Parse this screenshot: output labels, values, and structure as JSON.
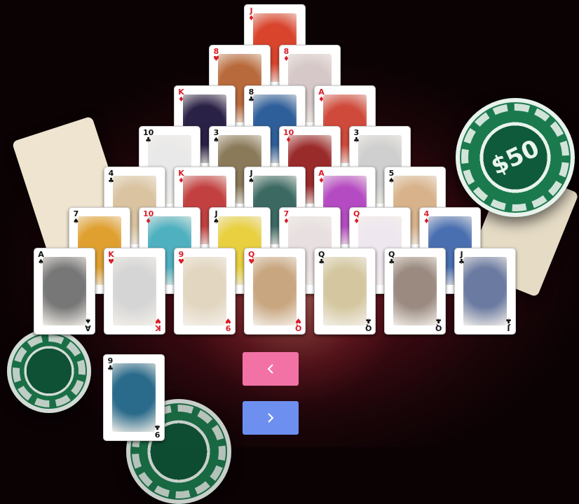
{
  "background": {
    "chip_label": "$50"
  },
  "colors": {
    "prev_button": "#f272a6",
    "next_button": "#6d8ff0"
  },
  "pyramid": [
    [
      {
        "rank": "J",
        "suit": "♦",
        "color": "red",
        "art": "#d9442d"
      }
    ],
    [
      {
        "rank": "8",
        "suit": "♥",
        "color": "red",
        "art": "#b86a3c"
      },
      {
        "rank": "8",
        "suit": "♦",
        "color": "red",
        "art": "#d6c8c8"
      }
    ],
    [
      {
        "rank": "K",
        "suit": "♦",
        "color": "red",
        "art": "#2a2146"
      },
      {
        "rank": "8",
        "suit": "♣",
        "color": "black",
        "art": "#2f5f9a"
      },
      {
        "rank": "A",
        "suit": "♦",
        "color": "red",
        "art": "#cf4a3b"
      }
    ],
    [
      {
        "rank": "10",
        "suit": "♣",
        "color": "black",
        "art": "#e9e9e9"
      },
      {
        "rank": "3",
        "suit": "♠",
        "color": "black",
        "art": "#8a7a5a"
      },
      {
        "rank": "10",
        "suit": "♦",
        "color": "red",
        "art": "#9a2b2b"
      },
      {
        "rank": "3",
        "suit": "♣",
        "color": "black",
        "art": "#cfcfcf"
      }
    ],
    [
      {
        "rank": "4",
        "suit": "♣",
        "color": "black",
        "art": "#d9c3a0"
      },
      {
        "rank": "K",
        "suit": "♦",
        "color": "red",
        "art": "#c24040"
      },
      {
        "rank": "J",
        "suit": "♠",
        "color": "black",
        "art": "#3c6a63"
      },
      {
        "rank": "A",
        "suit": "♦",
        "color": "red",
        "art": "#b54bc2"
      },
      {
        "rank": "5",
        "suit": "♠",
        "color": "black",
        "art": "#d8b28a"
      }
    ],
    [
      {
        "rank": "7",
        "suit": "♠",
        "color": "black",
        "art": "#e0a030"
      },
      {
        "rank": "10",
        "suit": "♦",
        "color": "red",
        "art": "#4fb0c0"
      },
      {
        "rank": "J",
        "suit": "♠",
        "color": "black",
        "art": "#e8d040"
      },
      {
        "rank": "7",
        "suit": "♦",
        "color": "red",
        "art": "#e8e0e0"
      },
      {
        "rank": "Q",
        "suit": "♦",
        "color": "red",
        "art": "#efe7ef"
      },
      {
        "rank": "4",
        "suit": "♦",
        "color": "red",
        "art": "#4a6fb0"
      }
    ],
    [
      {
        "rank": "A",
        "suit": "♠",
        "color": "black",
        "art": "#777777"
      },
      {
        "rank": "K",
        "suit": "♥",
        "color": "red",
        "art": "#d5d5d5"
      },
      {
        "rank": "9",
        "suit": "♥",
        "color": "red",
        "art": "#e2d6c0"
      },
      {
        "rank": "Q",
        "suit": "♥",
        "color": "red",
        "art": "#c8a680"
      },
      {
        "rank": "Q",
        "suit": "♣",
        "color": "black",
        "art": "#d4c7a0"
      },
      {
        "rank": "Q",
        "suit": "♣",
        "color": "black",
        "art": "#9a8a80"
      },
      {
        "rank": "J",
        "suit": "♣",
        "color": "black",
        "art": "#6a7aa0"
      }
    ]
  ],
  "waste_card": {
    "rank": "9",
    "suit": "♣",
    "color": "black",
    "art": "#2a6a8a"
  },
  "buttons": {
    "prev_icon": "chevron-left-icon",
    "next_icon": "chevron-right-icon"
  }
}
